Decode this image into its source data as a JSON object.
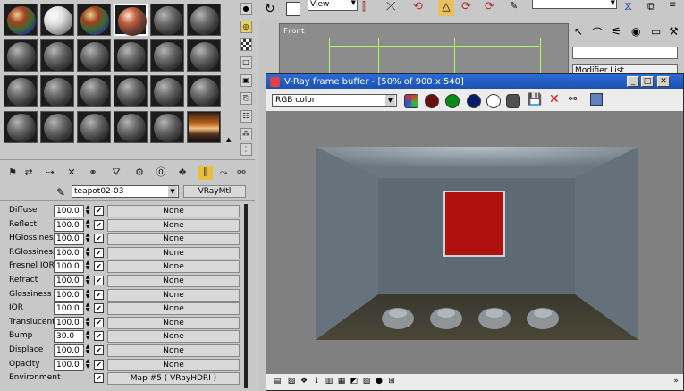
{
  "material_editor": {
    "material_name": "teapot02-03",
    "material_type": "VRayMtl",
    "maps": [
      {
        "label": "Diffuse",
        "value": "100.0",
        "checked": true,
        "map": "None"
      },
      {
        "label": "Reflect",
        "value": "100.0",
        "checked": true,
        "map": "None"
      },
      {
        "label": "HGlossiness",
        "value": "100.0",
        "checked": true,
        "map": "None"
      },
      {
        "label": "RGlossiness",
        "value": "100.0",
        "checked": true,
        "map": "None"
      },
      {
        "label": "Fresnel IOR",
        "value": "100.0",
        "checked": true,
        "map": "None"
      },
      {
        "label": "Refract",
        "value": "100.0",
        "checked": true,
        "map": "None"
      },
      {
        "label": "Glossiness",
        "value": "100.0",
        "checked": true,
        "map": "None"
      },
      {
        "label": "IOR",
        "value": "100.0",
        "checked": true,
        "map": "None"
      },
      {
        "label": "Translucent",
        "value": "100.0",
        "checked": true,
        "map": "None"
      },
      {
        "label": "Bump",
        "value": "30.0",
        "checked": true,
        "map": "None"
      },
      {
        "label": "Displace",
        "value": "100.0",
        "checked": true,
        "map": "None"
      },
      {
        "label": "Opacity",
        "value": "100.0",
        "checked": true,
        "map": "None"
      },
      {
        "label": "Environment",
        "value": "",
        "checked": true,
        "map": "Map #5  ( VRayHDRI )"
      }
    ],
    "slot_types": [
      "mosaic",
      "white",
      "mosaic",
      "chrome",
      "default",
      "default",
      "default",
      "default",
      "default",
      "default",
      "default",
      "default",
      "default",
      "default",
      "default",
      "default",
      "default",
      "default",
      "default",
      "default",
      "default",
      "default",
      "default",
      "hdri"
    ]
  },
  "main_toolbar": {
    "view_dropdown": "View",
    "viewport_label": "Front"
  },
  "command_panel": {
    "modifier_list": "Modifier List"
  },
  "frame_buffer": {
    "title": "V-Ray frame buffer - [50% of 900 x 540]",
    "channel": "RGB color",
    "colors": {
      "title_bar": "#1b4fb0",
      "red_panel": "#b01010"
    },
    "channel_buttons": [
      "red",
      "green",
      "blue",
      "white",
      "mono"
    ]
  }
}
